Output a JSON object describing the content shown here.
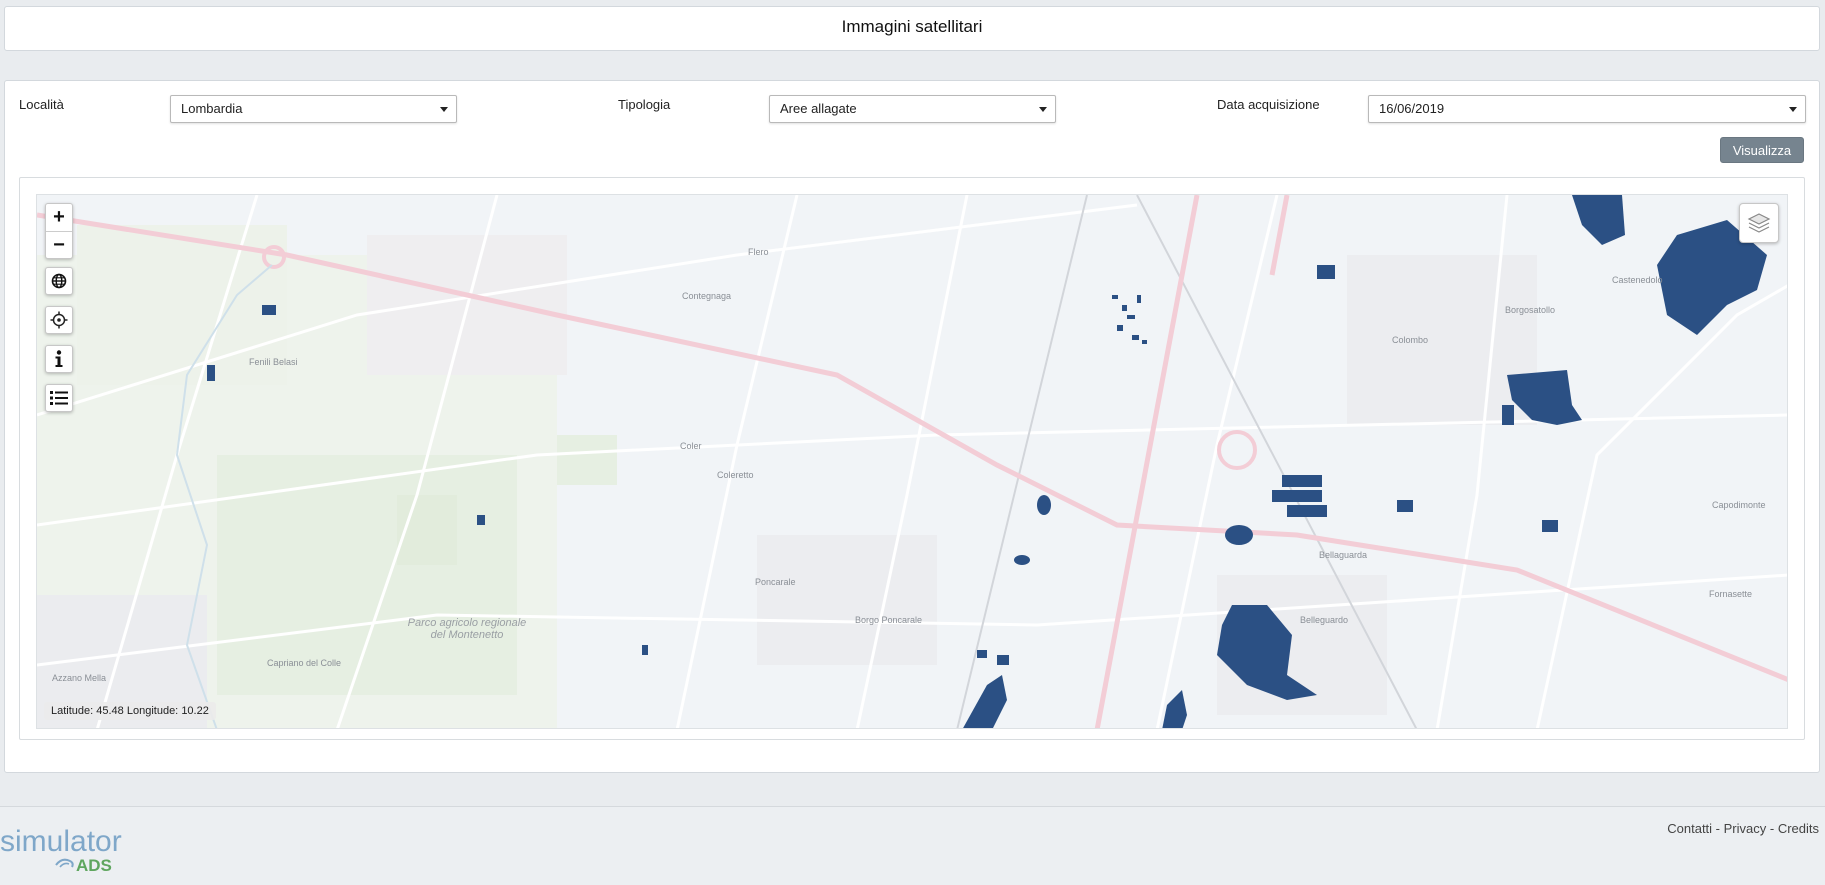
{
  "page": {
    "title": "Immagini satellitari"
  },
  "filters": {
    "location": {
      "label": "Località",
      "value": "Lombardia"
    },
    "type": {
      "label": "Tipologia",
      "value": "Aree allagate"
    },
    "date": {
      "label": "Data acquisizione",
      "value": "16/06/2019"
    },
    "submit_label": "Visualizza"
  },
  "map": {
    "zoom_in_label": "+",
    "zoom_out_label": "−",
    "coords": {
      "lat_label": "Latitude:",
      "lat": "45.48",
      "lon_label": "Longitude:",
      "lon": "10.22"
    },
    "place_labels": [
      "Azzano Mella",
      "Fenili Belasi",
      "Capriano del Colle",
      "Parco agricolo regionale del Montenetto",
      "Poncarale",
      "Borgo Poncarale",
      "Borgosatollo",
      "Bellaguarda",
      "Belleguardo",
      "Flero",
      "Castenedolo",
      "Capodimonte",
      "Fornasette",
      "Colombo",
      "Contegnaga",
      "Coler",
      "Coleretto"
    ],
    "flood_color": "#2b5084"
  },
  "footer": {
    "logo_text_1": "simulator",
    "logo_text_2": "ADS",
    "links": [
      "Contatti",
      "Privacy",
      "Credits"
    ],
    "separator": " - "
  }
}
